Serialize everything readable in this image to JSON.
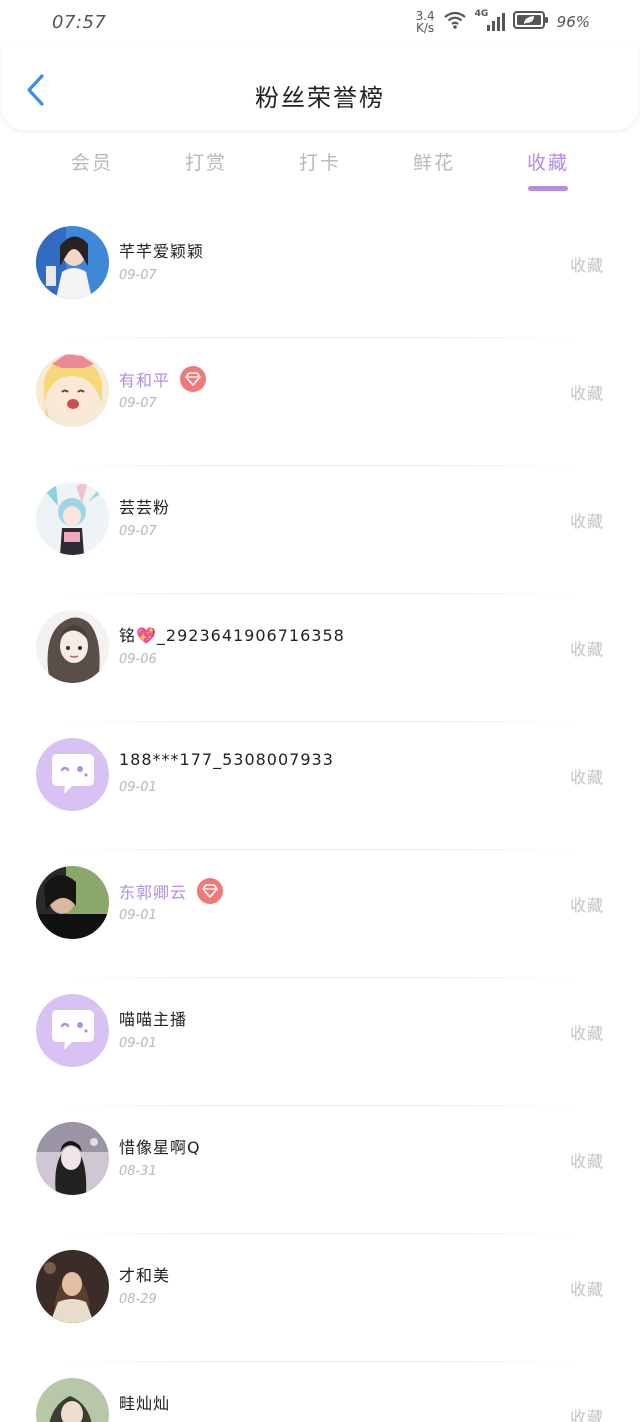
{
  "status_bar": {
    "time": "07:57",
    "net_speed_value": "3.4",
    "net_speed_unit": "K/s",
    "network": "4G",
    "battery": "96%"
  },
  "header": {
    "title": "粉丝荣誉榜"
  },
  "tabs": [
    {
      "label": "会员"
    },
    {
      "label": "打赏"
    },
    {
      "label": "打卡"
    },
    {
      "label": "鲜花"
    },
    {
      "label": "收藏",
      "active": true
    }
  ],
  "fans": [
    {
      "name": "芊芊爱颖颖",
      "date": "09-07",
      "action": "收藏",
      "vip": false
    },
    {
      "name": "有和平",
      "date": "09-07",
      "action": "收藏",
      "vip": true
    },
    {
      "name": "芸芸粉",
      "date": "09-07",
      "action": "收藏",
      "vip": false
    },
    {
      "name": "铭💖_2923641906716358",
      "date": "09-06",
      "action": "收藏",
      "vip": false
    },
    {
      "name": "188***177_5308007933",
      "date": "09-01",
      "action": "收藏",
      "vip": false
    },
    {
      "name": "东郭卿云",
      "date": "09-01",
      "action": "收藏",
      "vip": true
    },
    {
      "name": "喵喵主播",
      "date": "09-01",
      "action": "收藏",
      "vip": false
    },
    {
      "name": "惜像星啊Q",
      "date": "08-31",
      "action": "收藏",
      "vip": false
    },
    {
      "name": "才和美",
      "date": "08-29",
      "action": "收藏",
      "vip": false
    },
    {
      "name": "畦灿灿",
      "date": "",
      "action": "收藏",
      "vip": false
    }
  ],
  "colors": {
    "accent": "#b38de0",
    "vip_badge": "#f07a78",
    "back_arrow": "#3a8ee8",
    "muted_text": "#b8b8b8"
  }
}
